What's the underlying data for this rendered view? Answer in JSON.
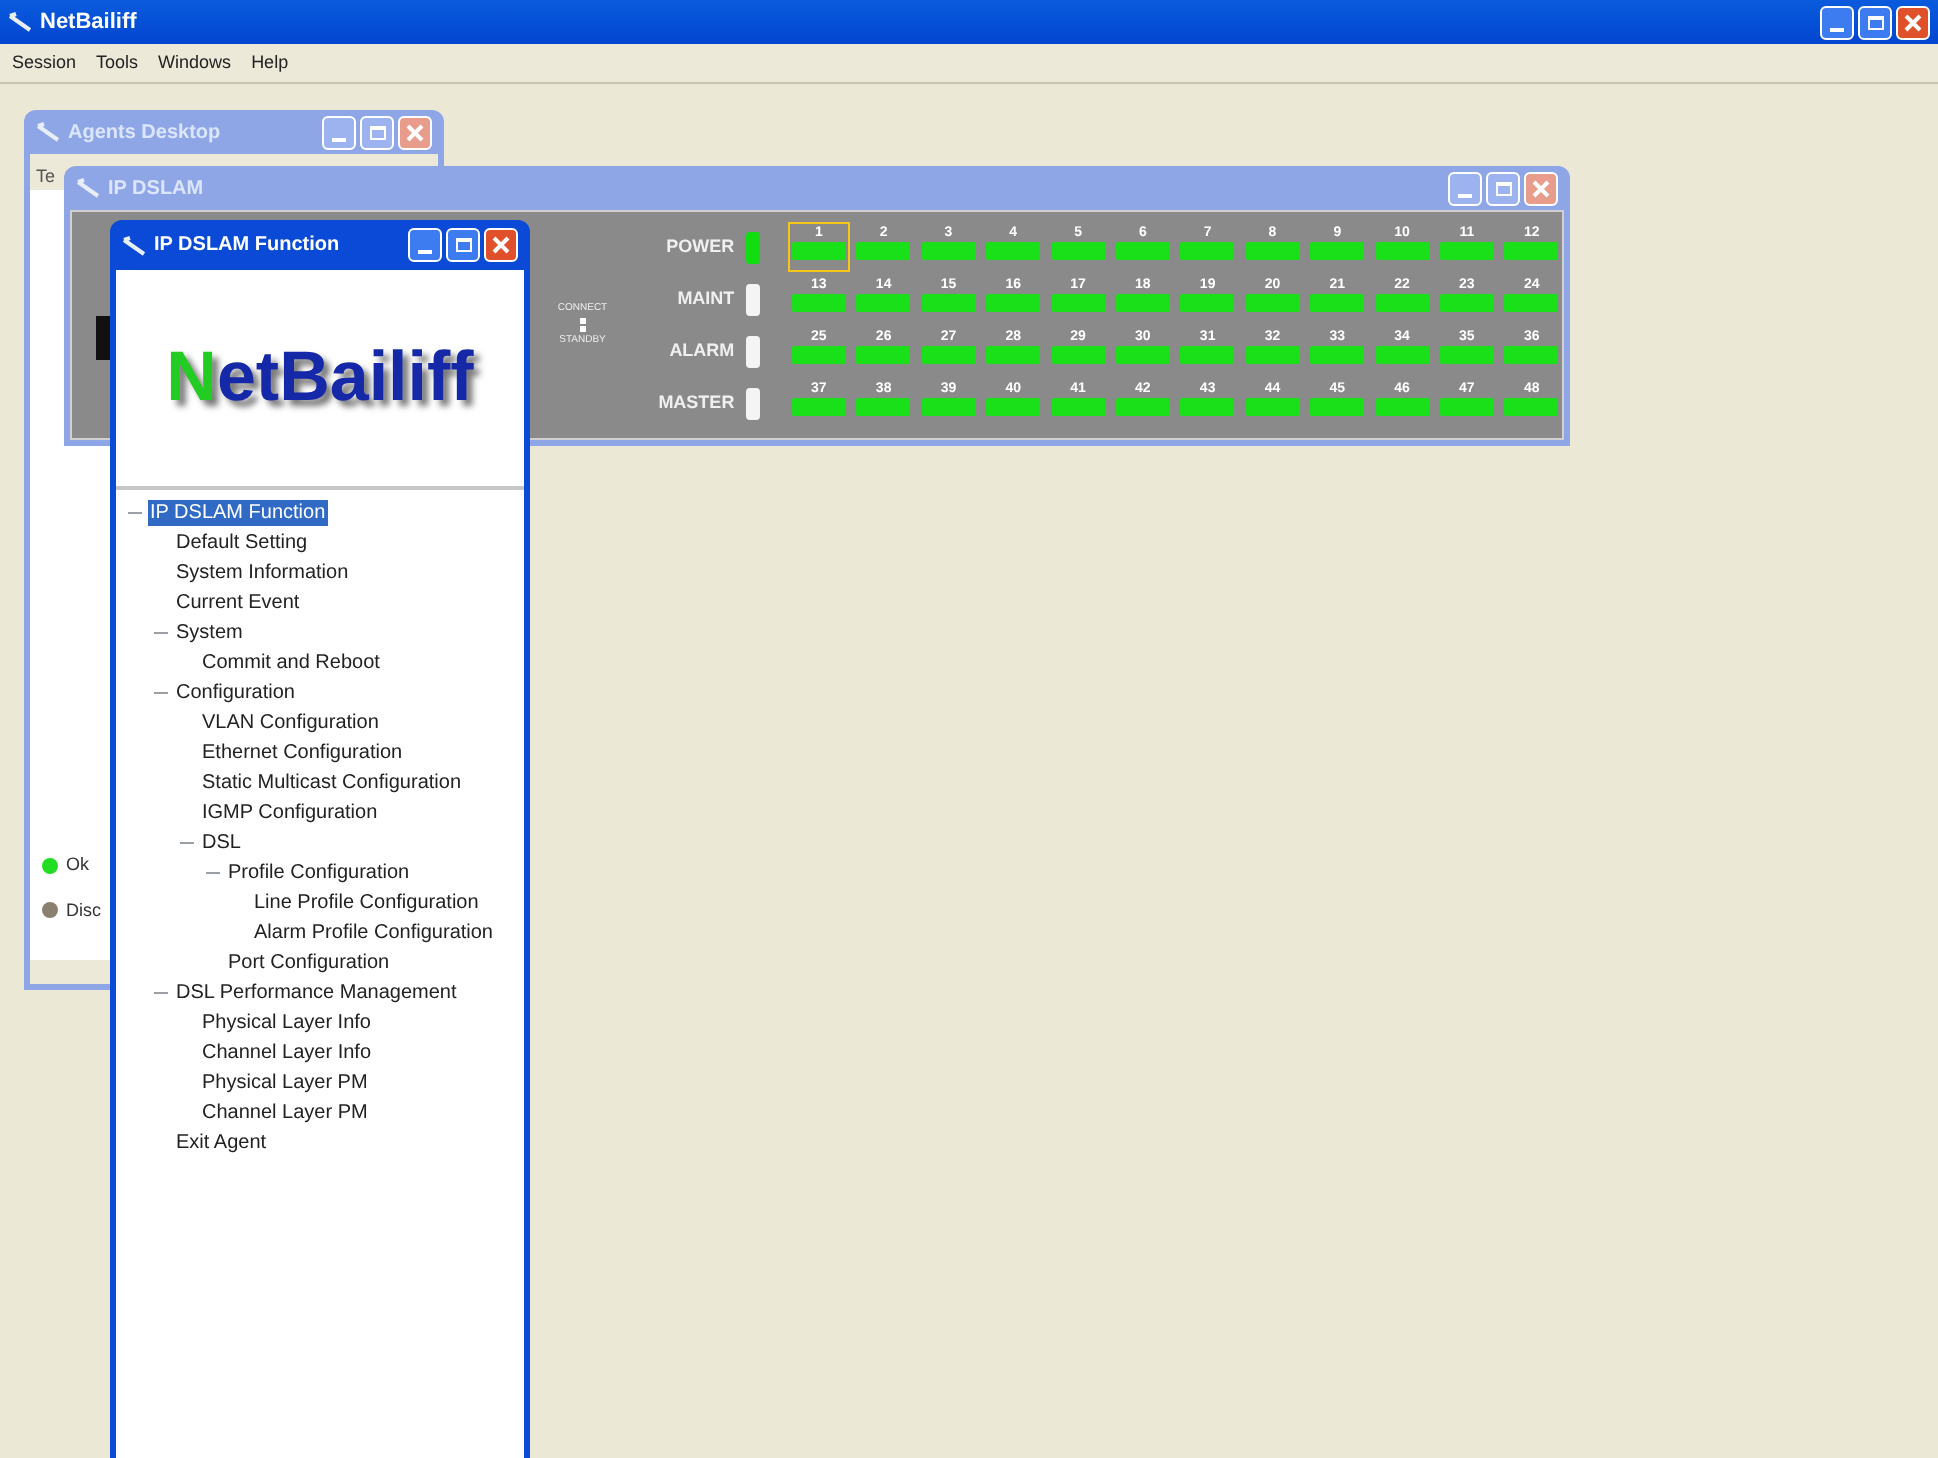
{
  "app": {
    "title": "NetBailiff",
    "menu": [
      "Session",
      "Tools",
      "Windows",
      "Help"
    ]
  },
  "agents_window": {
    "title": "Agents Desktop",
    "tab_text": "Te",
    "status": [
      {
        "label": "Ok",
        "color": "#22dd22"
      },
      {
        "label": "Disc",
        "color": "#8a8070"
      }
    ]
  },
  "dslam_window": {
    "title": "IP DSLAM",
    "mode_labels": [
      "CONNECT",
      "STANDBY"
    ],
    "indicators": [
      {
        "label": "POWER",
        "on": true
      },
      {
        "label": "MAINT",
        "on": false
      },
      {
        "label": "ALARM",
        "on": false
      },
      {
        "label": "MASTER",
        "on": false
      }
    ],
    "ports": [
      {
        "label": "1",
        "selected": true
      },
      {
        "label": "2",
        "selected": false
      },
      {
        "label": "3",
        "selected": false
      },
      {
        "label": "4",
        "selected": false
      },
      {
        "label": "5",
        "selected": false
      },
      {
        "label": "6",
        "selected": false
      },
      {
        "label": "7",
        "selected": false
      },
      {
        "label": "8",
        "selected": false
      },
      {
        "label": "9",
        "selected": false
      },
      {
        "label": "10",
        "selected": false
      },
      {
        "label": "11",
        "selected": false
      },
      {
        "label": "12",
        "selected": false
      },
      {
        "label": "13",
        "selected": false
      },
      {
        "label": "14",
        "selected": false
      },
      {
        "label": "15",
        "selected": false
      },
      {
        "label": "16",
        "selected": false
      },
      {
        "label": "17",
        "selected": false
      },
      {
        "label": "18",
        "selected": false
      },
      {
        "label": "19",
        "selected": false
      },
      {
        "label": "20",
        "selected": false
      },
      {
        "label": "21",
        "selected": false
      },
      {
        "label": "22",
        "selected": false
      },
      {
        "label": "23",
        "selected": false
      },
      {
        "label": "24",
        "selected": false
      },
      {
        "label": "25",
        "selected": false
      },
      {
        "label": "26",
        "selected": false
      },
      {
        "label": "27",
        "selected": false
      },
      {
        "label": "28",
        "selected": false
      },
      {
        "label": "29",
        "selected": false
      },
      {
        "label": "30",
        "selected": false
      },
      {
        "label": "31",
        "selected": false
      },
      {
        "label": "32",
        "selected": false
      },
      {
        "label": "33",
        "selected": false
      },
      {
        "label": "34",
        "selected": false
      },
      {
        "label": "35",
        "selected": false
      },
      {
        "label": "36",
        "selected": false
      },
      {
        "label": "37",
        "selected": false
      },
      {
        "label": "38",
        "selected": false
      },
      {
        "label": "39",
        "selected": false
      },
      {
        "label": "40",
        "selected": false
      },
      {
        "label": "41",
        "selected": false
      },
      {
        "label": "42",
        "selected": false
      },
      {
        "label": "43",
        "selected": false
      },
      {
        "label": "44",
        "selected": false
      },
      {
        "label": "45",
        "selected": false
      },
      {
        "label": "46",
        "selected": false
      },
      {
        "label": "47",
        "selected": false
      },
      {
        "label": "48",
        "selected": false
      }
    ]
  },
  "function_window": {
    "title": "IP DSLAM Function",
    "logo": {
      "initial": "N",
      "rest": "etBailiff"
    },
    "tree": [
      {
        "label": "IP DSLAM Function",
        "selected": true,
        "expanded": true,
        "children": [
          {
            "label": "Default Setting",
            "selected": false
          },
          {
            "label": "System Information",
            "selected": false
          },
          {
            "label": "Current Event",
            "selected": false
          },
          {
            "label": "System",
            "selected": false,
            "expanded": true,
            "children": [
              {
                "label": "Commit and Reboot",
                "selected": false
              }
            ]
          },
          {
            "label": "Configuration",
            "selected": false,
            "expanded": true,
            "children": [
              {
                "label": "VLAN Configuration",
                "selected": false
              },
              {
                "label": "Ethernet Configuration",
                "selected": false
              },
              {
                "label": "Static Multicast Configuration",
                "selected": false
              },
              {
                "label": "IGMP Configuration",
                "selected": false
              },
              {
                "label": "DSL",
                "selected": false,
                "expanded": true,
                "children": [
                  {
                    "label": "Profile Configuration",
                    "selected": false,
                    "expanded": true,
                    "children": [
                      {
                        "label": "Line Profile Configuration",
                        "selected": false
                      },
                      {
                        "label": "Alarm Profile Configuration",
                        "selected": false
                      }
                    ]
                  },
                  {
                    "label": "Port Configuration",
                    "selected": false
                  }
                ]
              }
            ]
          },
          {
            "label": "DSL Performance Management",
            "selected": false,
            "expanded": true,
            "children": [
              {
                "label": "Physical Layer Info",
                "selected": false
              },
              {
                "label": "Channel Layer Info",
                "selected": false
              },
              {
                "label": "Physical Layer PM",
                "selected": false
              },
              {
                "label": "Channel Layer PM",
                "selected": false
              }
            ]
          },
          {
            "label": "Exit Agent",
            "selected": false
          }
        ]
      }
    ]
  }
}
